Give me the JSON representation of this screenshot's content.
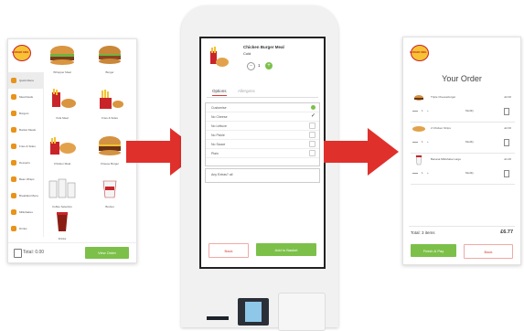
{
  "left_screen": {
    "logo_text": "BURGER KING",
    "categories": [
      {
        "label": "Quick Menu"
      },
      {
        "label": "Meal Deals"
      },
      {
        "label": "Burgers"
      },
      {
        "label": "Bucket Meals"
      },
      {
        "label": "Fries & Sides"
      },
      {
        "label": "Desserts"
      },
      {
        "label": "Bean Wraps"
      },
      {
        "label": "Breakfast Menu"
      },
      {
        "label": "Milkshakes"
      },
      {
        "label": "Drinks"
      }
    ],
    "tiles": [
      {
        "label": "Whopper Meal"
      },
      {
        "label": "Burger"
      },
      {
        "label": "Kids Meal"
      },
      {
        "label": "Fries & Sides"
      },
      {
        "label": "Chicken Meal"
      },
      {
        "label": "Cheese Burger"
      },
      {
        "label": "Coffee Selection"
      },
      {
        "label": "Bucket"
      },
      {
        "label": "Drinks"
      }
    ],
    "total_label": "Total: 0.00",
    "view_order_label": "View Order"
  },
  "kiosk": {
    "product_title": "Chicken Burger Meal",
    "product_subtitle": "Cold",
    "quantity": "1",
    "tabs": [
      "Options",
      "Allergens"
    ],
    "customise_label": "Customise",
    "options": [
      {
        "label": "No Cheese",
        "checked": true
      },
      {
        "label": "No Lettuce",
        "checked": false
      },
      {
        "label": "No Pickle",
        "checked": false
      },
      {
        "label": "No Sauce",
        "checked": false
      },
      {
        "label": "Plain",
        "checked": false
      }
    ],
    "extras_label": "Any Extras? all",
    "back_label": "Back",
    "add_label": "Add to Basket"
  },
  "right_screen": {
    "logo_text": "BURGER KING",
    "title": "Your Order",
    "items": [
      {
        "name": "Triple Cheeseburger",
        "price": "£2.00",
        "qty": "1",
        "modify": "Modify"
      },
      {
        "name": "2 Chicken Strips",
        "price": "£2.00",
        "qty": "1",
        "modify": "Modify"
      },
      {
        "name": "Banana Milkshake Large",
        "price": "£1.00",
        "qty": "1",
        "modify": "Modify"
      }
    ],
    "total_label": "Total: 3 items",
    "total_value": "£6.77",
    "finish_label": "Finish & Pay",
    "back_label": "Back"
  },
  "colors": {
    "arrow_red": "#e0302b",
    "button_green": "#7cc049",
    "accent_red": "#d93a33",
    "kiosk_body": "#f1f1f1"
  }
}
